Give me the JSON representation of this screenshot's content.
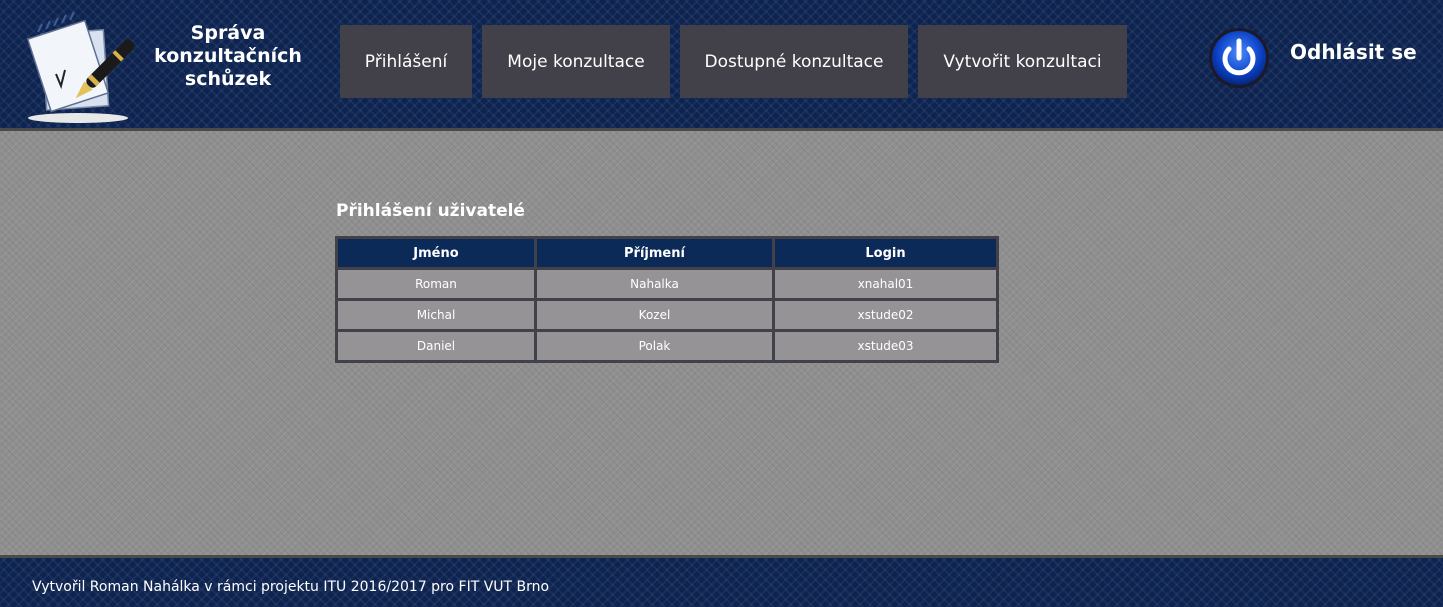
{
  "header": {
    "brand_title": "Správa konzultačních schůzek",
    "logo_icon": "notepad-pen-icon",
    "nav": [
      {
        "label": "Přihlášení"
      },
      {
        "label": "Moje konzultace"
      },
      {
        "label": "Dostupné konzultace"
      },
      {
        "label": "Vytvořit konzultaci"
      }
    ],
    "logout_icon": "power-icon",
    "logout_label": "Odhlásit se"
  },
  "main": {
    "title": "Přihlášení uživatelé",
    "table": {
      "headers": [
        "Jméno",
        "Příjmení",
        "Login"
      ],
      "rows": [
        [
          "Roman",
          "Nahalka",
          "xnahal01"
        ],
        [
          "Michal",
          "Kozel",
          "xstude02"
        ],
        [
          "Daniel",
          "Polak",
          "xstude03"
        ]
      ]
    }
  },
  "footer": {
    "text": "Vytvořil Roman Nahálka v rámci projektu ITU 2016/2017 pro FIT VUT Brno"
  },
  "colors": {
    "header_bg": "#0d2350",
    "nav_button_bg": "#424048",
    "table_header_bg": "#0c2a58",
    "table_cell_bg": "#959396",
    "page_bg": "#8f8f8f"
  }
}
